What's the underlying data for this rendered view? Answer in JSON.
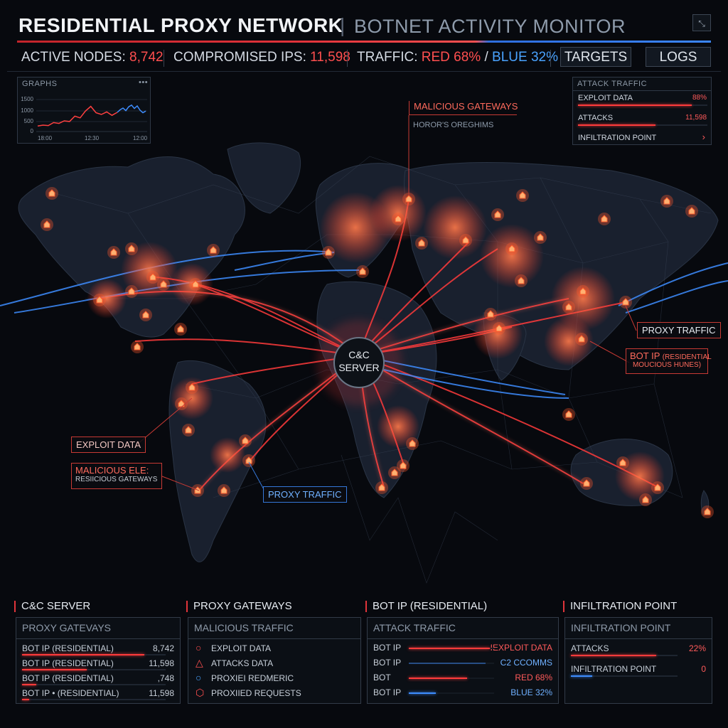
{
  "header": {
    "title": "RESIDENTIAL PROXY NETWORK",
    "separator": "|",
    "subtitle": "BOTNET ACTIVITY MONITOR",
    "close_glyph": "⤡"
  },
  "stats": {
    "active_label": "ACTIVE NODES:",
    "active_value": "8,742",
    "comp_label": "COMPROMISED IPS:",
    "comp_value": "11,598",
    "traffic_label": "TRAFFIC:",
    "traffic_red": "RED 68%",
    "traffic_slash": "/",
    "traffic_blue": "BLUE 32%",
    "targets_btn": "TARGETS",
    "logs_btn": "LOGS"
  },
  "graphs_panel": {
    "title": "GRAPHS",
    "menu": "•••",
    "y_ticks": [
      "1500",
      "1000",
      "500",
      "0"
    ],
    "x_ticks": [
      "18:00",
      "12:30",
      "12:00"
    ],
    "red_series": [
      260,
      300,
      280,
      420,
      380,
      500,
      470,
      720,
      640,
      960,
      1180,
      880,
      800,
      920,
      760,
      900
    ],
    "blue_series": [
      900,
      1020,
      1100,
      980,
      1160,
      1240,
      1080,
      1200,
      1000,
      880,
      960
    ]
  },
  "attack_panel": {
    "title": "ATTACK TRAFFIC",
    "rows": [
      {
        "label": "EXPLOIT DATA",
        "value": "88%",
        "fill": 0.88
      },
      {
        "label": "ATTACKS",
        "value": "11,598",
        "fill": 0.6
      },
      {
        "label": "INFILTRATION POINT",
        "value": "›",
        "fill": 0
      }
    ]
  },
  "map_labels": {
    "malicious_gateways": "MALICIOUS GATEWAYS",
    "malicious_gateways_sub": "HOROR'S OREGHIMS",
    "proxy_traffic_right": "PROXY TRAFFIC",
    "bot_ip_line1": "BOT IP",
    "bot_ip_line1_small": "(RESIDENTIAL",
    "bot_ip_line2": "MOUCIOUS HUNES)",
    "exploit_data": "EXPLOIT DATA",
    "malicious_ele": "MALICIOUS ELE:",
    "malicious_ele_sub": "RESIICIOUS GATEWAYS",
    "proxy_traffic_bottom": "PROXY TRAFFIC",
    "cc_line1": "C&C",
    "cc_line2": "SERVER"
  },
  "bottom": {
    "col1": {
      "heading": "C&C SERVER",
      "subheading": "PROXY GATEVAYS",
      "rows": [
        {
          "label": "BOT IP (RESIDENTIAL)",
          "value": "8,742",
          "fill": 0.85
        },
        {
          "label": "BOT IP (RESIDENTIAL)",
          "value": "11,598",
          "fill": 0.45
        },
        {
          "label": "BOT IP (RESIDENTIAL)",
          "value": ",748",
          "fill": 0.1
        },
        {
          "label": "BOT IP • (RESIDENTIAL)",
          "value": "11,598",
          "fill": 0.05
        }
      ]
    },
    "col2": {
      "heading": "PROXY GATEWAYS",
      "subheading": "MALICIOUS TRAFFIC",
      "items": [
        {
          "icon": "○",
          "label": "EXPLOIT DATA",
          "color": "#ff4f4f"
        },
        {
          "icon": "△",
          "label": "ATTACKS DATA",
          "color": "#ff4f4f"
        },
        {
          "icon": "○",
          "label": "PROXIEI REDMERIC",
          "color": "#4aa3ff"
        },
        {
          "icon": "⬡",
          "label": "PROXIIED REQUESTS",
          "color": "#ff4f4f"
        }
      ]
    },
    "col3": {
      "heading": "BOT IP (RESIDENTIAL)",
      "subheading": "ATTACK TRAFFIC",
      "rows": [
        {
          "label": "BOT IP",
          "value": "IEXPLOIT DATA",
          "color": "#ff5a5a",
          "fill": 0.95,
          "bar": "red"
        },
        {
          "label": "BOT IP",
          "value": "C2 CCOMMS",
          "color": "#6fb0ff",
          "fill": 0.9,
          "bar": "blue-dim"
        },
        {
          "label": "BOT",
          "value": "RED 68%",
          "color": "#ff5a5a",
          "fill": 0.68,
          "bar": "red"
        },
        {
          "label": "BOT IP",
          "value": "BLUE 32%",
          "color": "#6fb0ff",
          "fill": 0.32,
          "bar": "blue"
        }
      ]
    },
    "col4": {
      "heading": "INFILTRATION POINT",
      "subheading": "INFILTRATION POINT",
      "rows": [
        {
          "label": "ATTACKS",
          "value": "22%",
          "color": "#ff5a5a",
          "fill": 0.8,
          "bar": "red"
        },
        {
          "label": "INFILTRATION POINT",
          "value": "0",
          "color": "#ff5a5a",
          "fill": 0.2,
          "bar": "blue"
        }
      ]
    }
  },
  "colors": {
    "red": "#ff3b3b",
    "blue": "#3e8dff",
    "bg": "#07090e"
  }
}
